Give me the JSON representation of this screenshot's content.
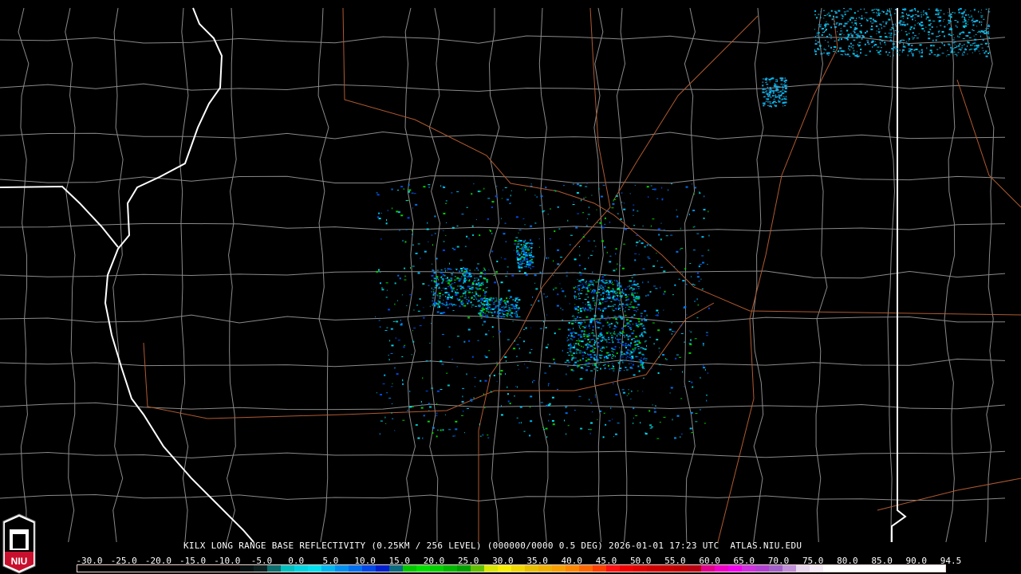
{
  "product_title": "KILX LONG RANGE BASE REFLECTIVITY (0.25KM / 256 LEVEL) (000000/0000 0.5 DEG) 2026-01-01 17:23 UTC  ATLAS.NIU.EDU",
  "logo_text": "NIU",
  "colorbar": {
    "labels": [
      "-30.0",
      "-25.0",
      "-20.0",
      "-15.0",
      "-10.0",
      "-5.0",
      "0.0",
      "5.0",
      "10.0",
      "15.0",
      "20.0",
      "25.0",
      "30.0",
      "35.0",
      "40.0",
      "45.0",
      "50.0",
      "55.0",
      "60.0",
      "65.0",
      "70.0",
      "75.0",
      "80.0",
      "85.0",
      "90.0",
      "94.5"
    ],
    "colors": [
      "#000000",
      "#000000",
      "#000000",
      "#000000",
      "#000000",
      "#000000",
      "#000000",
      "#000000",
      "#000000",
      "#000000",
      "#000000",
      "#000000",
      "#041010",
      "#0a2020",
      "#0c6e6e",
      "#00c0c0",
      "#00d4e0",
      "#00e0f0",
      "#00b8f0",
      "#0090f0",
      "#0070f0",
      "#0048e8",
      "#0020d0",
      "#0a6a80",
      "#00c800",
      "#00e000",
      "#00d000",
      "#00b800",
      "#00a000",
      "#60c000",
      "#d8e800",
      "#f8f000",
      "#f0d800",
      "#e8c000",
      "#f0b000",
      "#f8a000",
      "#ff8800",
      "#ff6800",
      "#ff4000",
      "#ff1010",
      "#f00000",
      "#e00000",
      "#d00000",
      "#c80000",
      "#c00000",
      "#b80010",
      "#e0008c",
      "#f000c8",
      "#f000f0",
      "#d030e0",
      "#b040d0",
      "#a060c8",
      "#c090d8",
      "#e8d8f0",
      "#f4ecf8",
      "#ffffff",
      "#ffffff",
      "#ffffff",
      "#ffffff",
      "#ffffff",
      "#ffffff",
      "#ffffff",
      "#ffffff",
      "#ffffff"
    ]
  }
}
